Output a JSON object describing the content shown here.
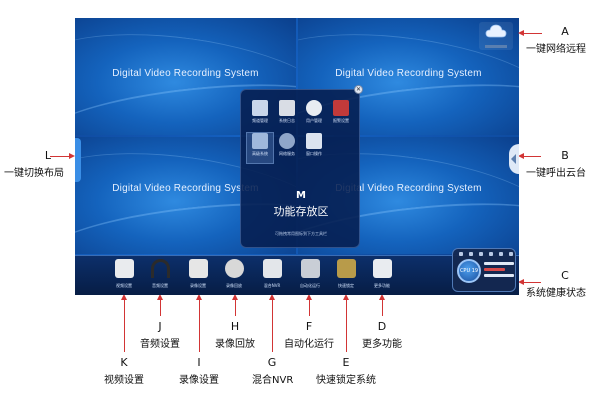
{
  "screen": {
    "quad_title": "Digital Video Recording System",
    "quad_titles": [
      "Digital Video Recording System",
      "Digital Video Recording System",
      "Digital Video Recording System",
      "Digital Video Recording System"
    ]
  },
  "cloud_widget": {
    "icon": "cloud-icon",
    "caption": ""
  },
  "popup_menu": {
    "items": [
      {
        "label": "频道管理",
        "icon": "monitor-icon",
        "color": "#c9d6ea"
      },
      {
        "label": "系统日志",
        "icon": "log-icon",
        "color": "#d9dde5"
      },
      {
        "label": "用户管理",
        "icon": "user-icon",
        "color": "#e8ecf2"
      },
      {
        "label": "报警设置",
        "icon": "alarm-icon",
        "color": "#c23a3a"
      },
      {
        "label": "高级系统",
        "icon": "computer-icon",
        "color": "#9fb8dc"
      },
      {
        "label": "网络服务",
        "icon": "network-icon",
        "color": "#8fa6c9"
      },
      {
        "label": "窗口操作",
        "icon": "window-icon",
        "color": "#dbe3ef"
      }
    ],
    "letter": "M",
    "title": "功能存放区",
    "hint": "可拖拽常用图标到下方工具栏"
  },
  "taskbar": {
    "buttons": [
      {
        "label": "视频设置",
        "icon": "video-settings-icon",
        "color": "#e9ebee"
      },
      {
        "label": "音频设置",
        "icon": "headphones-icon",
        "color": "#2b2b2b"
      },
      {
        "label": "录像设置",
        "icon": "film-icon",
        "color": "#e6e6e6"
      },
      {
        "label": "录像回放",
        "icon": "film-reel-icon",
        "color": "#d8d8d8"
      },
      {
        "label": "混合NVR",
        "icon": "nvr-icon",
        "color": "#e3e6ea"
      },
      {
        "label": "自动化运行",
        "icon": "automation-icon",
        "color": "#c9ced6"
      },
      {
        "label": "快速锁定",
        "icon": "lock-icon",
        "color": "#b89b4a"
      },
      {
        "label": "更多功能",
        "icon": "cube-icon",
        "color": "#e9ecf0"
      }
    ]
  },
  "health_widget": {
    "dial_label": "CPU 19"
  },
  "callouts": {
    "A": {
      "letter": "A",
      "text": "一键网络远程"
    },
    "B": {
      "letter": "B",
      "text": "一键呼出云台"
    },
    "C": {
      "letter": "C",
      "text": "系统健康状态"
    },
    "D": {
      "letter": "D",
      "text": "更多功能"
    },
    "E": {
      "letter": "E",
      "text": "快速锁定系统"
    },
    "F": {
      "letter": "F",
      "text": "自动化运行"
    },
    "G": {
      "letter": "G",
      "text": "混合NVR"
    },
    "H": {
      "letter": "H",
      "text": "录像回放"
    },
    "I": {
      "letter": "I",
      "text": "录像设置"
    },
    "J": {
      "letter": "J",
      "text": "音频设置"
    },
    "K": {
      "letter": "K",
      "text": "视频设置"
    },
    "L": {
      "letter": "L",
      "text": "一键切换布局"
    }
  },
  "colors": {
    "accent_line": "#d23535",
    "screen_blue": "#1565c8",
    "taskbar": "#0c2f6a"
  }
}
